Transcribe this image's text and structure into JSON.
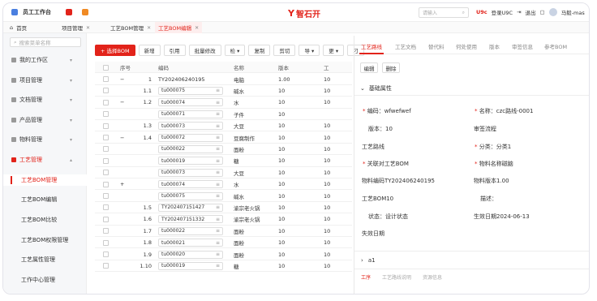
{
  "topbar": {
    "app_title": "员工工作台",
    "brand_name": "智石开",
    "search_placeholder": "请输入",
    "u9c_label": "U9c",
    "login_u9c": "登录U9C",
    "logout": "退出",
    "user": "马毅-mas"
  },
  "tabs": [
    {
      "label": "首页"
    },
    {
      "label": "项目管理"
    },
    {
      "label": "工艺BOM管理"
    },
    {
      "label": "工艺BOM编辑",
      "active": true
    }
  ],
  "sidebar": {
    "search_placeholder": "搜索菜单名称",
    "items": [
      {
        "label": "我的工作区"
      },
      {
        "label": "项目管理"
      },
      {
        "label": "文档管理"
      },
      {
        "label": "产品管理"
      },
      {
        "label": "物料管理"
      },
      {
        "label": "工艺管理",
        "expanded": true
      }
    ],
    "subitems": [
      {
        "label": "工艺BOM管理",
        "active": true
      },
      {
        "label": "工艺BOM编辑"
      },
      {
        "label": "工艺BOM比较"
      },
      {
        "label": "工艺BOM权限管理"
      },
      {
        "label": "工艺属性管理"
      },
      {
        "label": "工作中心管理"
      }
    ]
  },
  "toolbar": {
    "buttons": [
      "+ 选择BOM",
      "新增",
      "引用",
      "批量修改",
      "检 ▾",
      "复制",
      "剪切",
      "导 ▾",
      "更 ▾",
      "刁"
    ]
  },
  "grid": {
    "headers": [
      "序号",
      "编码",
      "名称",
      "版本",
      "工"
    ],
    "rows": [
      {
        "toggle": "−",
        "seq": "1",
        "code": "TY202406240195",
        "name": "电脑",
        "version": "1.00",
        "w": "10",
        "input": false
      },
      {
        "toggle": "",
        "seq": "1.1",
        "code": "tu000075",
        "name": "碱水",
        "version": "10",
        "w": "10",
        "input": true
      },
      {
        "toggle": "−",
        "seq": "1.2",
        "code": "tu000074",
        "name": "水",
        "version": "10",
        "w": "10",
        "input": true
      },
      {
        "toggle": "",
        "seq": "",
        "code": "tu000071",
        "name": "子件",
        "version": "10",
        "w": "",
        "input": true
      },
      {
        "toggle": "",
        "seq": "1.3",
        "code": "tu000073",
        "name": "大豆",
        "version": "10",
        "w": "10",
        "input": true
      },
      {
        "toggle": "−",
        "seq": "1.4",
        "code": "tu000072",
        "name": "豆腐制作",
        "version": "10",
        "w": "10",
        "input": true
      },
      {
        "toggle": "",
        "seq": "",
        "code": "tu000022",
        "name": "面粉",
        "version": "10",
        "w": "10",
        "input": true
      },
      {
        "toggle": "",
        "seq": "",
        "code": "tu000019",
        "name": "糖",
        "version": "10",
        "w": "10",
        "input": true
      },
      {
        "toggle": "",
        "seq": "",
        "code": "tu000073",
        "name": "大豆",
        "version": "10",
        "w": "10",
        "input": true
      },
      {
        "toggle": "+",
        "seq": "",
        "code": "tu000074",
        "name": "水",
        "version": "10",
        "w": "10",
        "input": true
      },
      {
        "toggle": "",
        "seq": "",
        "code": "tu000075",
        "name": "碱水",
        "version": "10",
        "w": "10",
        "input": true
      },
      {
        "toggle": "",
        "seq": "1.5",
        "code": "TY202407151427",
        "name": "渝宗老火锅",
        "version": "10",
        "w": "10",
        "input": true
      },
      {
        "toggle": "",
        "seq": "1.6",
        "code": "TY202407151332",
        "name": "渝宗老火锅",
        "version": "10",
        "w": "10",
        "input": true
      },
      {
        "toggle": "",
        "seq": "1.7",
        "code": "tu000022",
        "name": "面粉",
        "version": "10",
        "w": "10",
        "input": true
      },
      {
        "toggle": "",
        "seq": "1.8",
        "code": "tu000021",
        "name": "面粉",
        "version": "10",
        "w": "10",
        "input": true
      },
      {
        "toggle": "",
        "seq": "1.9",
        "code": "tu000020",
        "name": "面粉",
        "version": "10",
        "w": "10",
        "input": true
      },
      {
        "toggle": "",
        "seq": "1.10",
        "code": "tu000019",
        "name": "糖",
        "version": "10",
        "w": "10",
        "input": true
      }
    ]
  },
  "right": {
    "tabs": [
      "工艺路线",
      "工艺文档",
      "替代料",
      "何处使用",
      "版本",
      "审签信息",
      "参考BOM"
    ],
    "edit_label": "编辑",
    "delete_label": "删除",
    "section_title": "基础属性",
    "fields": {
      "code": "编码：wfwefwef",
      "name": "名称：czc路线-0001",
      "version": "版本：10",
      "approval": "审签流程",
      "route": "工艺路线",
      "category": "分类：分类1",
      "linked_bom": "关联对工艺BOM",
      "material_name": "物料名称磁脑",
      "material_code": "物料编码TY202406240195",
      "material_version": "物料版本1.00",
      "bom_number": "工艺BOM10",
      "description": "描述：",
      "status": "状态：设计状态",
      "effective": "生效日期2024-06-13",
      "expire": "失效日期"
    },
    "subsection": "a1",
    "bottom_tabs": [
      "工序",
      "工艺路线说明",
      "资源信息"
    ]
  }
}
